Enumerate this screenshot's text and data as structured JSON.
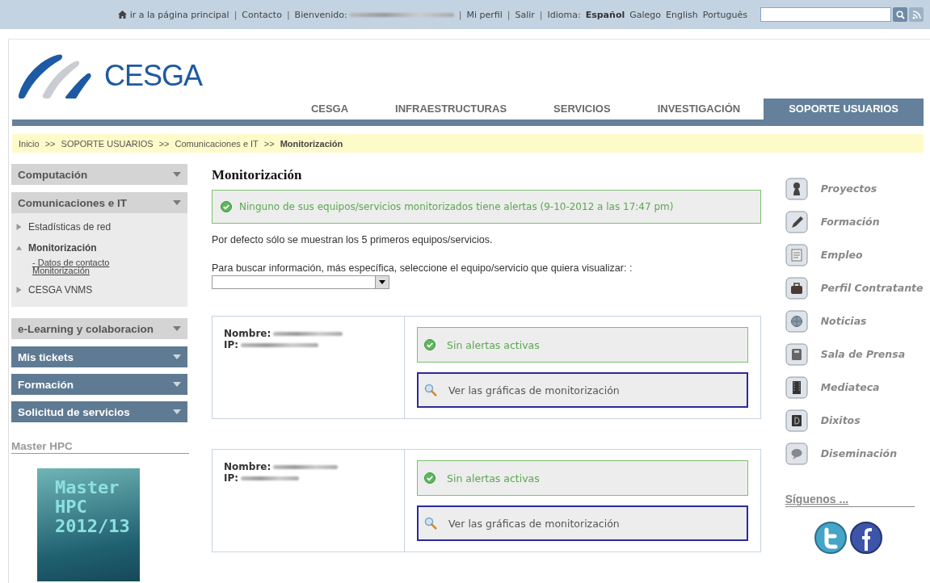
{
  "top_bar": {
    "links": [
      {
        "kind": "home",
        "label": "ir a la página principal"
      },
      {
        "kind": "link",
        "label": "Contacto"
      },
      {
        "kind": "user",
        "label": "Bienvenido:"
      },
      {
        "kind": "link",
        "label": "Mi perfil"
      },
      {
        "kind": "link",
        "label": "Salir"
      }
    ],
    "separator": "|",
    "language_label": "Idioma:",
    "languages": [
      {
        "label": "Español",
        "selected": true
      },
      {
        "label": "Galego",
        "selected": false
      },
      {
        "label": "English",
        "selected": false
      },
      {
        "label": "Português",
        "selected": false
      }
    ]
  },
  "logo": {
    "text": "CESGA"
  },
  "nav": [
    {
      "label": "CESGA",
      "selected": false
    },
    {
      "label": "INFRAESTRUCTURAS",
      "selected": false
    },
    {
      "label": "SERVICIOS",
      "selected": false
    },
    {
      "label": "INVESTIGACIÓN",
      "selected": false
    },
    {
      "label": "SOPORTE USUARIOS",
      "selected": true
    }
  ],
  "breadcrumb": [
    {
      "label": "Inicio"
    },
    {
      "label": "SOPORTE USUARIOS"
    },
    {
      "label": "Comunicaciones e IT"
    },
    {
      "label": "Monitorización"
    }
  ],
  "breadcrumb_separator": ">>",
  "sidebar": {
    "sections": [
      {
        "label": "Computación",
        "kind": "light",
        "expanded": false
      },
      {
        "label": "Comunicaciones e IT",
        "kind": "light",
        "expanded": true,
        "children": [
          {
            "label": "Estadísticas de red",
            "expanded": false
          },
          {
            "label": "Monitorización",
            "expanded": true,
            "selected": true,
            "children": [
              {
                "label": "- Datos de contacto Monitorización"
              }
            ]
          },
          {
            "label": "CESGA VNMS",
            "expanded": false
          }
        ]
      },
      {
        "label": "e-Learning y colaboracion",
        "kind": "light",
        "expanded": false
      },
      {
        "label": "Mis tickets",
        "kind": "dark",
        "expanded": false
      },
      {
        "label": "Formación",
        "kind": "dark",
        "expanded": false
      },
      {
        "label": "Solicitud de servicios",
        "kind": "dark",
        "expanded": false
      }
    ],
    "promo": {
      "title": "Master HPC",
      "banner_lines": [
        "Master",
        "HPC",
        "2012/13"
      ]
    }
  },
  "main": {
    "title": "Monitorización",
    "alert": {
      "kind": "ok",
      "text": "Ninguno de sus equipos/servicios monitorizados tiene alertas (9-10-2012 a las 17:47 pm)"
    },
    "note": "Por defecto sólo se muestran los 5 primeros equipos/servicios.",
    "select_label": "Para buscar información, más específica, seleccione el equipo/servicio que quiera visualizar: :",
    "devices": [
      {
        "name_label": "Nombre:",
        "ip_label": "IP:",
        "status": {
          "kind": "ok",
          "text": "Sin alertas activas"
        },
        "graphs_link": "Ver las gráficas de monitorización"
      },
      {
        "name_label": "Nombre:",
        "ip_label": "IP:",
        "status": {
          "kind": "ok",
          "text": "Sin alertas activas"
        },
        "graphs_link": "Ver las gráficas de monitorización"
      }
    ]
  },
  "right_menu": {
    "items": [
      {
        "kind": "projects",
        "label": "Proyectos"
      },
      {
        "kind": "training",
        "label": "Formación"
      },
      {
        "kind": "jobs",
        "label": "Empleo"
      },
      {
        "kind": "contractor",
        "label": "Perfil Contratante"
      },
      {
        "kind": "news",
        "label": "Noticias"
      },
      {
        "kind": "press",
        "label": "Sala de Prensa"
      },
      {
        "kind": "media",
        "label": "Mediateca"
      },
      {
        "kind": "dixitos",
        "label": "Dixitos"
      },
      {
        "kind": "dissemination",
        "label": "Diseminación"
      }
    ],
    "follow_title": "Síguenos ..."
  }
}
